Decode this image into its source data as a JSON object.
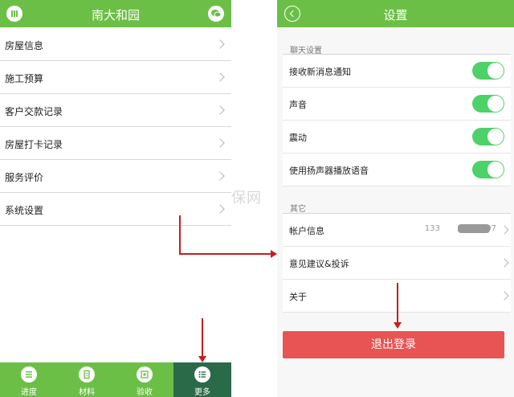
{
  "left": {
    "title": "南大和园",
    "menu": [
      {
        "label": "房屋信息"
      },
      {
        "label": "施工预算"
      },
      {
        "label": "客户交款记录"
      },
      {
        "label": "房屋打卡记录"
      },
      {
        "label": "服务评价"
      },
      {
        "label": "系统设置"
      }
    ],
    "tabs": [
      {
        "label": "进度",
        "icon": "progress-icon"
      },
      {
        "label": "材料",
        "icon": "document-icon"
      },
      {
        "label": "验收",
        "icon": "inspection-icon"
      },
      {
        "label": "更多",
        "icon": "list-icon",
        "active": true
      }
    ]
  },
  "right": {
    "title": "设置",
    "chat_section": "聊天设置",
    "toggles": [
      {
        "label": "接收新消息通知",
        "on": true
      },
      {
        "label": "声音",
        "on": true
      },
      {
        "label": "震动",
        "on": true
      },
      {
        "label": "使用扬声器播放语音",
        "on": true
      }
    ],
    "other_section": "其它",
    "account": {
      "label": "帐户信息",
      "phone_prefix": "133",
      "phone_suffix": "107"
    },
    "feedback": {
      "label": "意见建议&投诉"
    },
    "about": {
      "label": "关于"
    },
    "logout": "退出登录"
  },
  "watermark": "保网",
  "colors": {
    "header_green": "#6cbf46",
    "active_tab": "#2a6a49",
    "toggle_on": "#4cd269",
    "logout_red": "#e85453",
    "annotation_red": "#c41f1f"
  }
}
